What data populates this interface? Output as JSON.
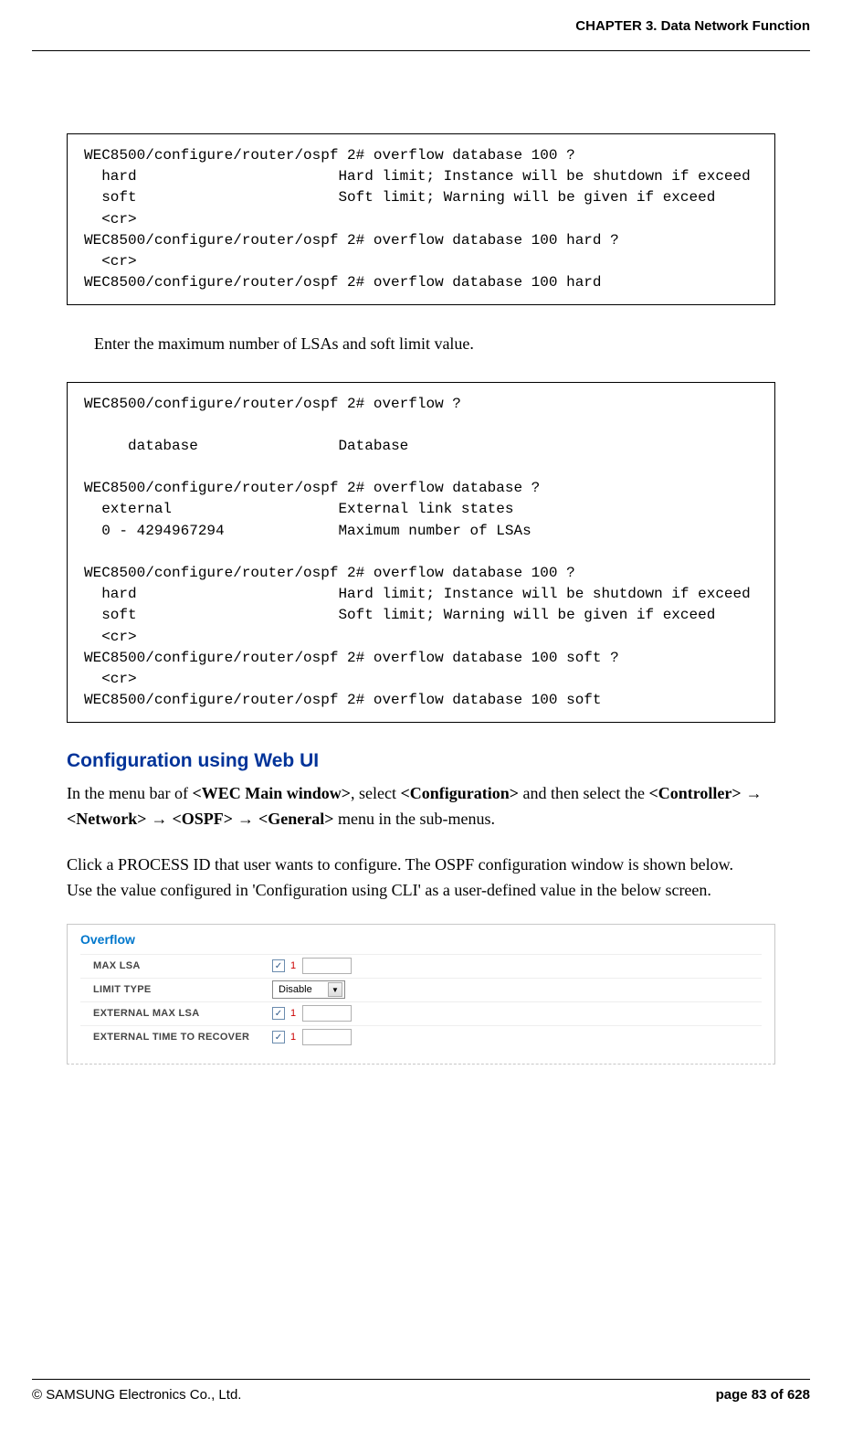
{
  "header": {
    "chapter": "CHAPTER 3. Data Network Function"
  },
  "code1": "WEC8500/configure/router/ospf 2# overflow database 100 ?\n  hard                       Hard limit; Instance will be shutdown if exceed\n  soft                       Soft limit; Warning will be given if exceed\n  <cr>\nWEC8500/configure/router/ospf 2# overflow database 100 hard ?\n  <cr>\nWEC8500/configure/router/ospf 2# overflow database 100 hard",
  "instruction1": "Enter the maximum number of LSAs and soft limit value.",
  "code2": "WEC8500/configure/router/ospf 2# overflow ?\n\n     database                Database\n\nWEC8500/configure/router/ospf 2# overflow database ?\n  external                   External link states\n  0 - 4294967294             Maximum number of LSAs\n\nWEC8500/configure/router/ospf 2# overflow database 100 ?\n  hard                       Hard limit; Instance will be shutdown if exceed\n  soft                       Soft limit; Warning will be given if exceed\n  <cr>\nWEC8500/configure/router/ospf 2# overflow database 100 soft ?\n  <cr>\nWEC8500/configure/router/ospf 2# overflow database 100 soft",
  "section_heading": "Configuration using Web UI",
  "paragraph1_prefix": "In the menu bar of ",
  "paragraph1_bold1": "<WEC Main window>",
  "paragraph1_mid1": ", select ",
  "paragraph1_bold2": "<Configuration>",
  "paragraph1_mid2": " and then select the ",
  "paragraph1_bold3": "<Controller>",
  "paragraph1_arrow": " → ",
  "paragraph1_bold4": "<Network>",
  "paragraph1_bold5": "<OSPF>",
  "paragraph1_bold6": "<General>",
  "paragraph1_suffix": " menu in the sub-menus.",
  "paragraph2": "Click a PROCESS ID that user wants to configure. The OSPF configuration window is shown below.",
  "paragraph3": "Use the value configured in 'Configuration using CLI' as a user-defined value in the below screen.",
  "panel": {
    "title": "Overflow",
    "rows": {
      "max_lsa": {
        "label": "MAX LSA",
        "num": "1"
      },
      "limit_type": {
        "label": "LIMIT TYPE",
        "value": "Disable"
      },
      "ext_max_lsa": {
        "label": "EXTERNAL MAX LSA",
        "num": "1"
      },
      "ext_time": {
        "label": "EXTERNAL TIME TO RECOVER",
        "num": "1"
      }
    }
  },
  "footer": {
    "copyright": "© SAMSUNG Electronics Co., Ltd.",
    "page": "page 83 of 628"
  }
}
